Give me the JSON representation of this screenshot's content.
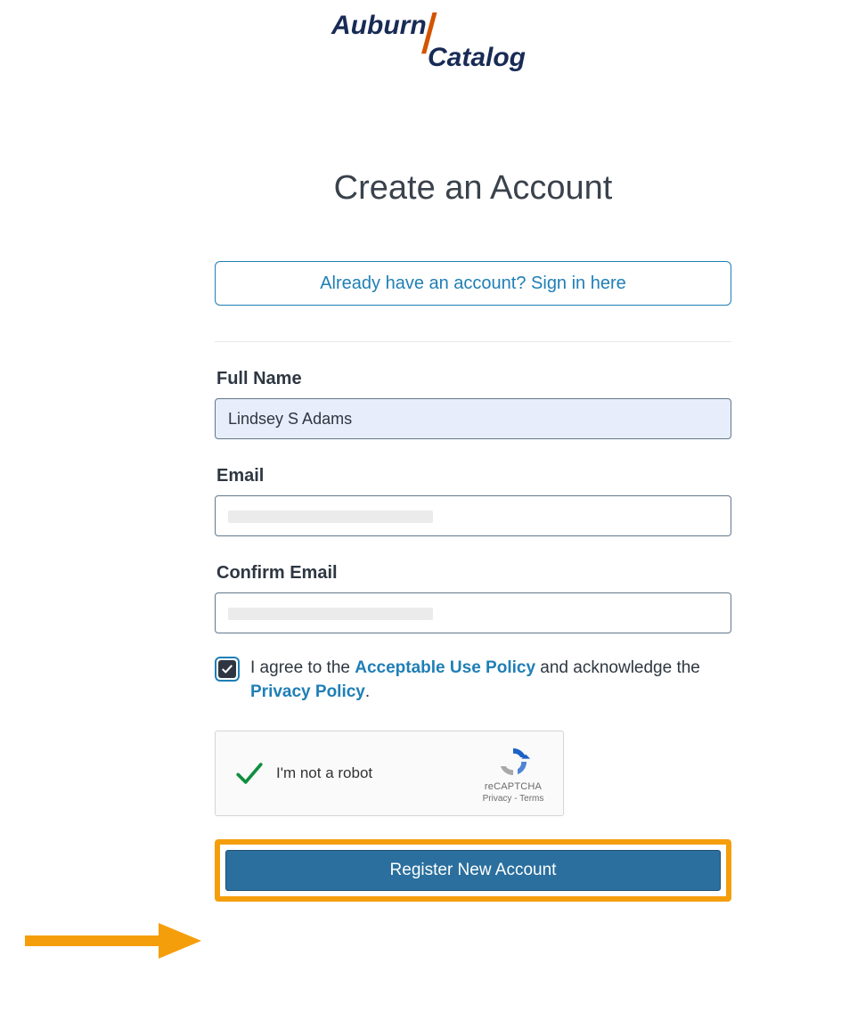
{
  "brand": {
    "word1": "Auburn",
    "word2": "Catalog",
    "text_color": "#182b56",
    "slash_color": "#d35400"
  },
  "title": "Create an Account",
  "signin_button": "Already have an account? Sign in here",
  "fields": {
    "full_name": {
      "label": "Full Name",
      "value": "Lindsey S Adams"
    },
    "email": {
      "label": "Email",
      "value": ""
    },
    "confirm_email": {
      "label": "Confirm Email",
      "value": ""
    }
  },
  "consent": {
    "checked": true,
    "prefix": "I agree to the ",
    "policy1": "Acceptable Use Policy",
    "middle": " and acknowledge the ",
    "policy2": "Privacy Policy",
    "suffix": "."
  },
  "recaptcha": {
    "verified": true,
    "label": "I'm not a robot",
    "brand": "reCAPTCHA",
    "links": "Privacy - Terms"
  },
  "register_button": "Register New Account",
  "highlight_color": "#f59e0b",
  "link_color": "#1f7fb6"
}
